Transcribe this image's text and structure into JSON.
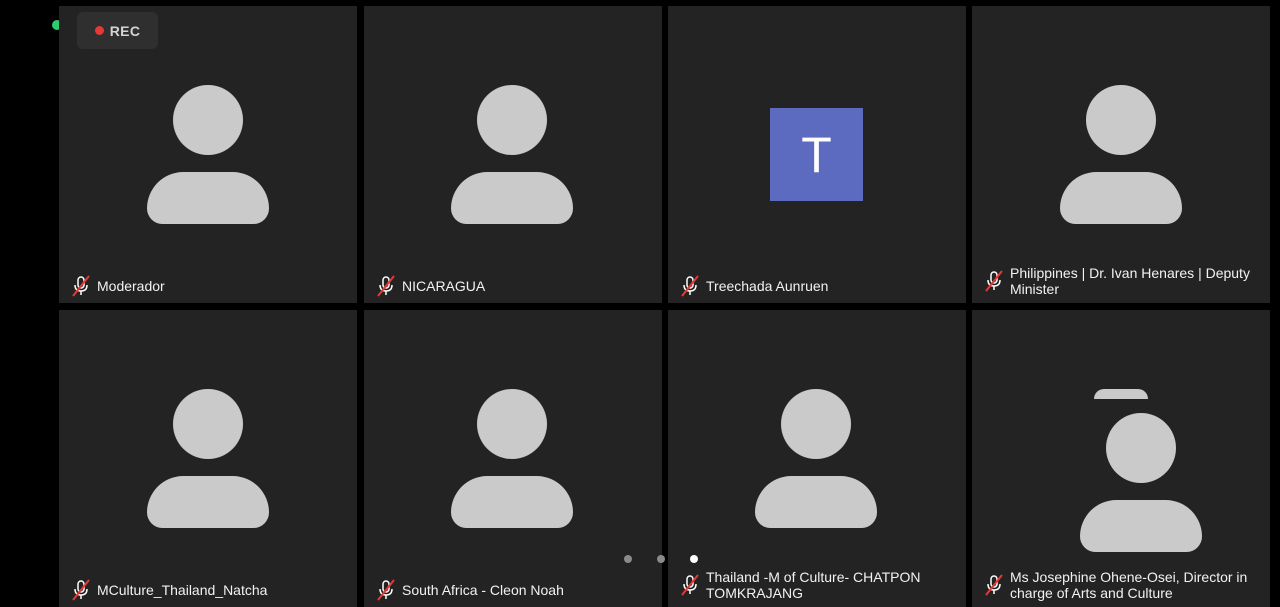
{
  "recording": {
    "label": "REC",
    "color": "#e53935"
  },
  "status_dot_color": "#2ecc71",
  "participants": [
    {
      "name": "Moderador",
      "avatar": "person-placeholder",
      "muted": true
    },
    {
      "name": "NICARAGUA",
      "avatar": "person-placeholder",
      "muted": true
    },
    {
      "name": "Treechada Aunruen",
      "avatar": "letter",
      "initial": "T",
      "avatar_color": "#5c6bc0",
      "muted": true
    },
    {
      "name": "Philippines | Dr. Ivan Henares | Deputy Minister",
      "avatar": "person-placeholder",
      "muted": true
    },
    {
      "name": "MCulture_Thailand_Natcha",
      "avatar": "person-placeholder",
      "muted": true
    },
    {
      "name": "South Africa - Cleon Noah",
      "avatar": "person-placeholder",
      "muted": true
    },
    {
      "name": "Thailand -M of Culture- CHATPON TOMKRAJANG",
      "avatar": "person-placeholder",
      "muted": true
    },
    {
      "name": "Ms Josephine Ohene-Osei, Director in charge of Arts and Culture",
      "avatar": "person-placeholder",
      "muted": true
    }
  ],
  "pagination": {
    "pages": 3,
    "current": 3
  },
  "icons": {
    "mic": "mic-muted-icon"
  }
}
